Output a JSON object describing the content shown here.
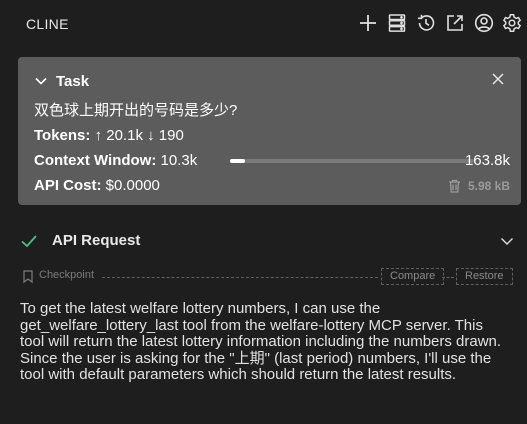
{
  "header": {
    "title": "CLINE",
    "icons": [
      "plus-icon",
      "server-icon",
      "history-icon",
      "popout-icon",
      "account-icon",
      "gear-icon"
    ]
  },
  "task": {
    "label": "Task",
    "question": "双色球上期开出的号码是多少?",
    "tokens_label": "Tokens:",
    "tokens_in": "20.1k",
    "tokens_out": "190",
    "context_label": "Context Window:",
    "context_used": "10.3k",
    "context_total": "163.8k",
    "context_fraction": 0.063,
    "cost_label": "API Cost:",
    "cost_value": "$0.0000",
    "size": "5.98 kB"
  },
  "api_request": {
    "label": "API Request"
  },
  "checkpoint": {
    "label": "Checkpoint",
    "compare": "Compare",
    "restore": "Restore"
  },
  "message": "To get the latest welfare lottery numbers, I can use the get_welfare_lottery_last tool from the welfare-lottery MCP server. This tool will return the latest lottery information including the numbers drawn. Since the user is asking for the \"上期\" (last period) numbers, I'll use the tool with default parameters which should return the latest results.",
  "colors": {
    "background": "#1e1e1e",
    "task_card": "#5c5c5c",
    "success": "#4ec07a"
  }
}
